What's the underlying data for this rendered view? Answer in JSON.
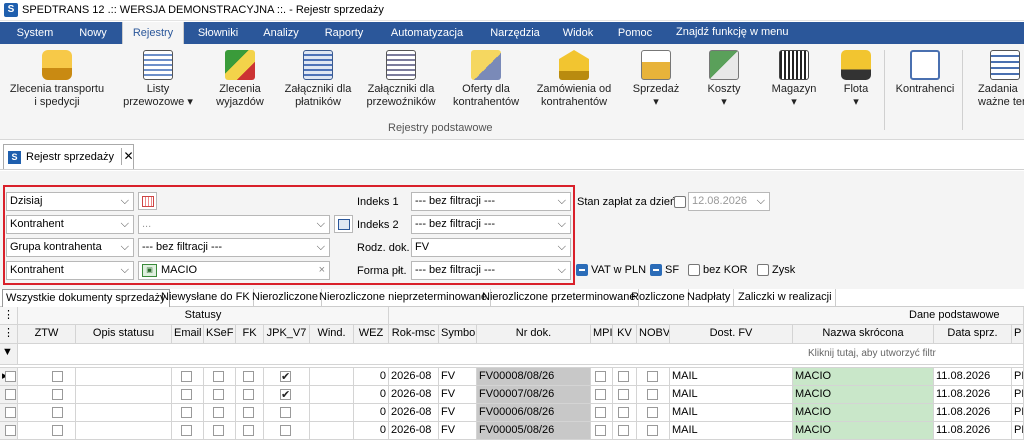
{
  "window": {
    "title": "SPEDTRANS 12 .:: WERSJA DEMONSTRACYJNA ::. - Rejestr sprzedaży"
  },
  "menu": {
    "items": [
      "System",
      "Nowy",
      "Rejestry",
      "Słowniki",
      "Analizy",
      "Raporty",
      "Automatyzacja",
      "Narzędzia",
      "Widok",
      "Pomoc"
    ],
    "active": "Rejestry",
    "search_label": "Znajdź funkcję w menu"
  },
  "ribbon": {
    "buttons": [
      {
        "label": "Zlecenia transportu\ni spedycji",
        "icon": "truck-icon"
      },
      {
        "label": "Listy\nprzewozowe ▾",
        "icon": "waybill-icon"
      },
      {
        "label": "Zlecenia\nwyjazdów",
        "icon": "departure-orders-icon"
      },
      {
        "label": "Załączniki dla\npłatników",
        "icon": "payer-attachments-icon"
      },
      {
        "label": "Załączniki dla\nprzewoźników",
        "icon": "carrier-attachments-icon"
      },
      {
        "label": "Oferty dla\nkontrahentów",
        "icon": "offers-icon"
      },
      {
        "label": "Zamówienia od\nkontrahentów",
        "icon": "orders-icon"
      },
      {
        "label": "Sprzedaż\n▾",
        "icon": "sales-icon"
      },
      {
        "label": "Koszty\n▾",
        "icon": "costs-icon"
      },
      {
        "label": "Magazyn\n▾",
        "icon": "warehouse-icon"
      },
      {
        "label": "Flota\n▾",
        "icon": "fleet-icon"
      },
      {
        "label": "Kontrahenci",
        "icon": "contractors-icon"
      },
      {
        "label": "Zadania\nważne term",
        "icon": "tasks-icon"
      }
    ],
    "group_label": "Rejestry podstawowe"
  },
  "doc_tab": {
    "label": "Rejestr sprzedaży",
    "close": "✕"
  },
  "filters": {
    "row1_combo": "Dzisiaj",
    "row2_combo": "Kontrahent",
    "row2_value": "...",
    "row3_combo": "Grupa kontrahenta",
    "row3_value": "--- bez filtracji ---",
    "row4_combo": "Kontrahent",
    "row4_value": "MACIO",
    "row4_clear": "×",
    "index1_label": "Indeks 1",
    "index1_value": "--- bez filtracji ---",
    "index2_label": "Indeks 2",
    "index2_value": "--- bez filtracji ---",
    "doctype_label": "Rodz. dok.",
    "doctype_value": "FV",
    "payform_label": "Forma płt.",
    "payform_value": "--- bez filtracji ---",
    "payment_state_label": "Stan zapłat za dzień",
    "payment_state_date": "12.08.2026",
    "opt_vat": "VAT w PLN",
    "opt_sf": "SF",
    "opt_bezkor": "bez KOR",
    "opt_zysk": "Zysk"
  },
  "filter_tabs": [
    "Wszystkie dokumenty sprzedaży",
    "Niewysłane do FK",
    "Nierozliczone",
    "Nierozliczone nieprzeterminowane",
    "Nierozliczone przeterminowane",
    "Rozliczone",
    "Nadpłaty",
    "Zaliczki w realizacji"
  ],
  "grid": {
    "band_statusy": "Statusy",
    "band_dane": "Dane podstawowe",
    "columns": [
      "ZTW",
      "Opis statusu",
      "Email",
      "KSeF",
      "FK",
      "JPK_V7",
      "Wind.",
      "WEZ",
      "Rok-msc",
      "Symbo",
      "Nr dok.",
      "MPI",
      "KV",
      "NOBV",
      "Dost. FV",
      "Nazwa skrócona",
      "Data sprz.",
      "P"
    ],
    "filter_hint": "Kliknij tutaj, aby utworzyć filtr",
    "rows": [
      {
        "jpk": true,
        "wez": "0",
        "rokmsc": "2026-08",
        "symbol": "FV",
        "nrdok": "FV00008/08/26",
        "dost": "MAIL",
        "nazwa": "MACIO",
        "data": "11.08.2026",
        "p": "PF"
      },
      {
        "jpk": true,
        "wez": "0",
        "rokmsc": "2026-08",
        "symbol": "FV",
        "nrdok": "FV00007/08/26",
        "dost": "MAIL",
        "nazwa": "MACIO",
        "data": "11.08.2026",
        "p": "PF"
      },
      {
        "jpk": false,
        "wez": "0",
        "rokmsc": "2026-08",
        "symbol": "FV",
        "nrdok": "FV00006/08/26",
        "dost": "MAIL",
        "nazwa": "MACIO",
        "data": "11.08.2026",
        "p": "PF"
      },
      {
        "jpk": false,
        "wez": "0",
        "rokmsc": "2026-08",
        "symbol": "FV",
        "nrdok": "FV00005/08/26",
        "dost": "MAIL",
        "nazwa": "MACIO",
        "data": "11.08.2026",
        "p": "PF"
      }
    ]
  },
  "colors": {
    "menubar": "#2b579a",
    "highlight_box": "#d9202a",
    "name_cell": "#c9e7c9",
    "docnum_cell": "#c8c8c8"
  }
}
